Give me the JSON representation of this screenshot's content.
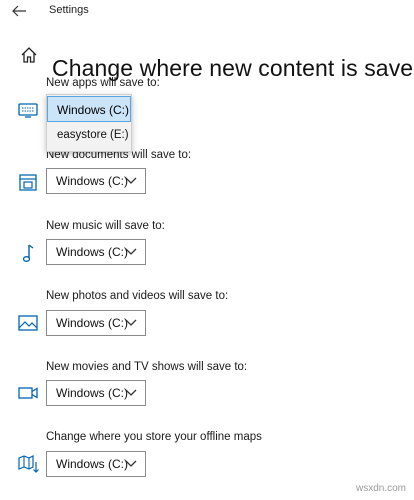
{
  "window": {
    "title": "Settings"
  },
  "page": {
    "title": "Change where new content is saved"
  },
  "sections": [
    {
      "label": "New apps will save to:",
      "value": "Windows (C:)",
      "icon": "monitor-icon"
    },
    {
      "label": "New documents will save to:",
      "value": "Windows (C:)",
      "icon": "documents-drive-icon"
    },
    {
      "label": "New music will save to:",
      "value": "Windows (C:)",
      "icon": "music-note-icon"
    },
    {
      "label": "New photos and videos will save to:",
      "value": "Windows (C:)",
      "icon": "picture-icon"
    },
    {
      "label": "New movies and TV shows will save to:",
      "value": "Windows (C:)",
      "icon": "video-camera-icon"
    },
    {
      "label": "Change where you store your offline maps",
      "value": "Windows (C:)",
      "icon": "map-icon"
    }
  ],
  "apps_dropdown_options": [
    "Windows (C:)",
    "easystore (E:)"
  ],
  "watermark": "wsxdn.com",
  "colors": {
    "accent": "#0063b1",
    "selection_bg": "#cce4f7",
    "selection_border": "#5aa4e0"
  }
}
